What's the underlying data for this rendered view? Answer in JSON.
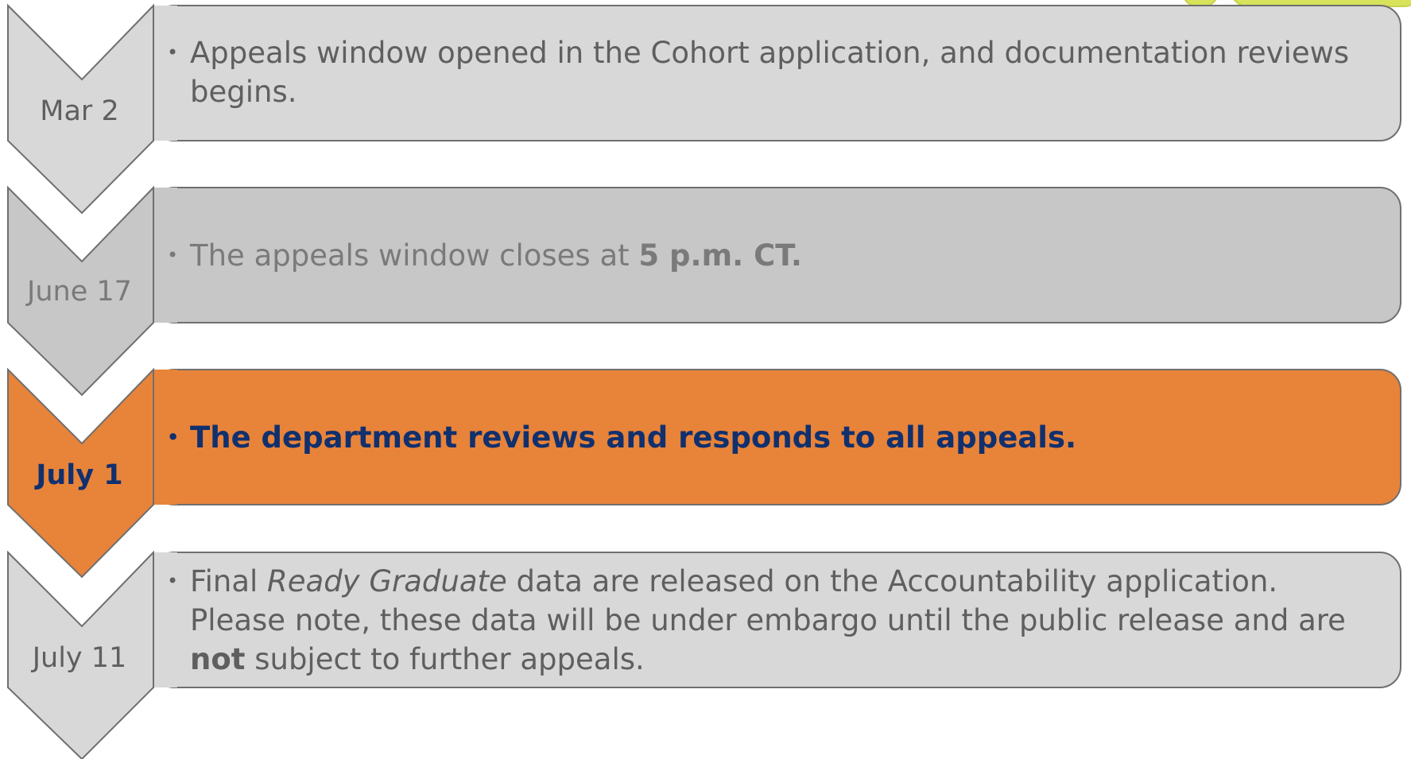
{
  "colors": {
    "step_fill_light": "#d8d8d8",
    "step_fill_mid": "#c7c7c7",
    "step_fill_highlight": "#e8833a",
    "outline": "#6f6f6f",
    "highlight_text": "#10306e",
    "deco_accent": "#d7e35a"
  },
  "steps": [
    {
      "date": "Mar 2",
      "segments": [
        {
          "text": "Appeals window opened in the Cohort application, and documentation reviews begins.",
          "style": "normal"
        }
      ]
    },
    {
      "date": "June 17",
      "segments": [
        {
          "text": "The appeals window closes at ",
          "style": "normal"
        },
        {
          "text": "5 p.m. CT.",
          "style": "bold"
        }
      ]
    },
    {
      "date": "July 1",
      "highlighted": true,
      "segments": [
        {
          "text": "The department reviews and responds to all appeals.",
          "style": "bold"
        }
      ]
    },
    {
      "date": "July 11",
      "segments": [
        {
          "text": "Final ",
          "style": "normal"
        },
        {
          "text": "Ready Graduate",
          "style": "italic"
        },
        {
          "text": " data are released on the Accountability application. Please note, these data will be under embargo until the public release and are ",
          "style": "normal"
        },
        {
          "text": "not",
          "style": "bold"
        },
        {
          "text": " subject to further appeals.",
          "style": "normal"
        }
      ]
    }
  ],
  "bullet_glyph": "•"
}
